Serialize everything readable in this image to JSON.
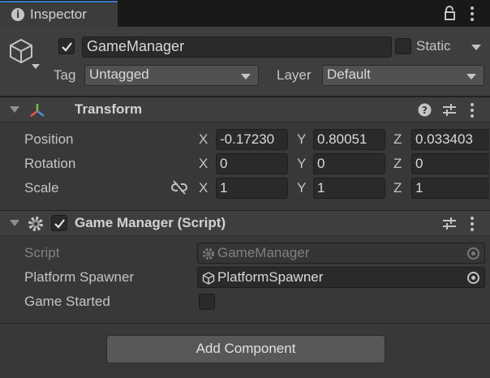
{
  "tab": {
    "title": "Inspector",
    "icon": "info-icon"
  },
  "gameobject": {
    "name": "GameManager",
    "active": true,
    "static_label": "Static",
    "static": false,
    "tag_label": "Tag",
    "tag_value": "Untagged",
    "layer_label": "Layer",
    "layer_value": "Default"
  },
  "transform": {
    "title": "Transform",
    "position": {
      "label": "Position",
      "x": "-0.17230",
      "y": "0.80051",
      "z": "0.033403"
    },
    "rotation": {
      "label": "Rotation",
      "x": "0",
      "y": "0",
      "z": "0"
    },
    "scale": {
      "label": "Scale",
      "x": "1",
      "y": "1",
      "z": "1"
    },
    "axis_labels": {
      "x": "X",
      "y": "Y",
      "z": "Z"
    }
  },
  "script_component": {
    "title": "Game Manager (Script)",
    "enabled": true,
    "script_label": "Script",
    "script_value": "GameManager",
    "spawner_label": "Platform Spawner",
    "spawner_value": "PlatformSpawner",
    "started_label": "Game Started",
    "started_value": false
  },
  "add_component_label": "Add Component",
  "colors": {
    "background": "#383838",
    "header": "#3e3e3e",
    "field": "#2a2a2a",
    "accent": "#3a79bb"
  }
}
